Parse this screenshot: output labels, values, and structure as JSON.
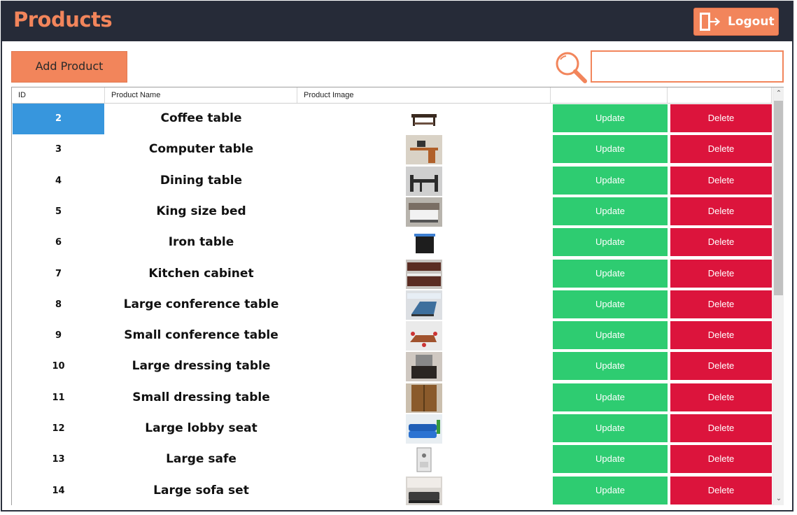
{
  "header": {
    "title": "Products",
    "logout_label": "Logout"
  },
  "toolbar": {
    "add_label": "Add Product",
    "search_value": ""
  },
  "columns": [
    "ID",
    "Product Name",
    "Product Image",
    "",
    ""
  ],
  "rows": [
    {
      "id": "2",
      "name": "Coffee table",
      "update": "Update",
      "delete": "Delete",
      "selected": true
    },
    {
      "id": "3",
      "name": "Computer table",
      "update": "Update",
      "delete": "Delete"
    },
    {
      "id": "4",
      "name": "Dining table",
      "update": "Update",
      "delete": "Delete"
    },
    {
      "id": "5",
      "name": "King size bed",
      "update": "Update",
      "delete": "Delete"
    },
    {
      "id": "6",
      "name": "Iron table",
      "update": "Update",
      "delete": "Delete"
    },
    {
      "id": "7",
      "name": "Kitchen cabinet",
      "update": "Update",
      "delete": "Delete"
    },
    {
      "id": "8",
      "name": "Large conference table",
      "update": "Update",
      "delete": "Delete"
    },
    {
      "id": "9",
      "name": "Small conference table",
      "update": "Update",
      "delete": "Delete"
    },
    {
      "id": "10",
      "name": "Large dressing table",
      "update": "Update",
      "delete": "Delete"
    },
    {
      "id": "11",
      "name": "Small dressing table",
      "update": "Update",
      "delete": "Delete"
    },
    {
      "id": "12",
      "name": "Large lobby seat",
      "update": "Update",
      "delete": "Delete"
    },
    {
      "id": "13",
      "name": "Large safe",
      "update": "Update",
      "delete": "Delete"
    },
    {
      "id": "14",
      "name": "Large sofa set",
      "update": "Update",
      "delete": "Delete"
    }
  ],
  "colors": {
    "accent": "#f2855b",
    "header_bg": "#262b38",
    "update": "#2ecc71",
    "delete": "#dc143c",
    "selected": "#3796dd"
  },
  "icons": {
    "logout": "logout-icon",
    "search": "magnifier-icon",
    "scroll_up": "chevron-up-icon",
    "scroll_down": "chevron-down-icon"
  }
}
